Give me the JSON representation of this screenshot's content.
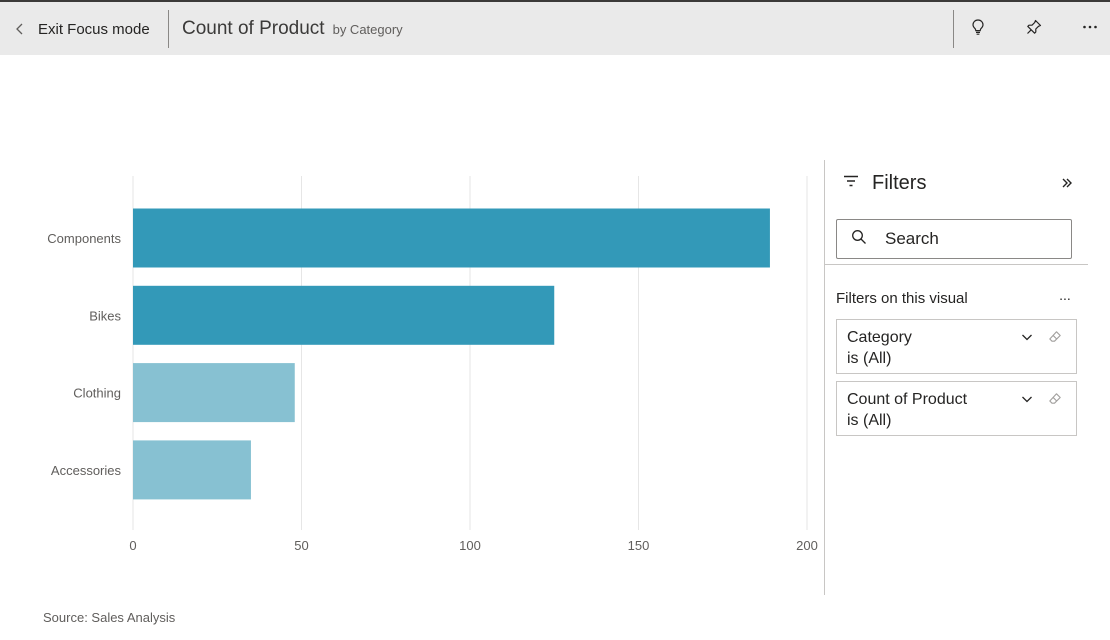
{
  "header": {
    "exit_label": "Exit Focus mode",
    "title": "Count of Product",
    "subtitle": "by Category",
    "icons": [
      "chevron-left-icon",
      "lightbulb-icon",
      "pin-icon",
      "more-options-icon"
    ]
  },
  "chart_data": {
    "type": "bar",
    "orientation": "horizontal",
    "title": "Count of Product",
    "subtitle": "by Category",
    "categories": [
      "Components",
      "Bikes",
      "Clothing",
      "Accessories"
    ],
    "values": [
      189,
      125,
      48,
      35
    ],
    "xlim": [
      0,
      200
    ],
    "x_ticks": [
      "0",
      "50",
      "100",
      "150",
      "200"
    ],
    "grid": "vertical",
    "colors": [
      "#3399b8",
      "#3399b8",
      "#87c1d2",
      "#87c1d2"
    ]
  },
  "source": "Source: Sales Analysis",
  "filters": {
    "title": "Filters",
    "search_placeholder": "Search",
    "section_label": "Filters on this visual",
    "section_more": "...",
    "items": [
      {
        "name": "Category",
        "state": "is (All)"
      },
      {
        "name": "Count of Product",
        "state": "is (All)"
      }
    ]
  }
}
